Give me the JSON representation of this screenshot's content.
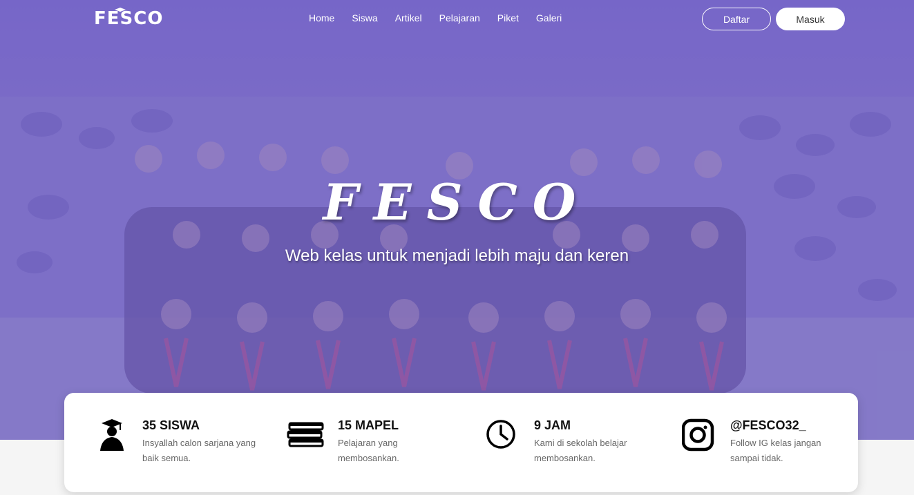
{
  "brand": {
    "logo_text": "FESCO"
  },
  "nav": {
    "links": [
      "Home",
      "Siswa",
      "Artikel",
      "Pelajaran",
      "Piket",
      "Galeri"
    ],
    "register_label": "Daftar",
    "login_label": "Masuk"
  },
  "hero": {
    "title": "FESCO",
    "subtitle": "Web kelas untuk menjadi lebih maju dan keren"
  },
  "stats": [
    {
      "icon": "graduate-icon",
      "title": "35 SISWA",
      "desc": "Insyallah calon sarjana yang baik semua."
    },
    {
      "icon": "books-icon",
      "title": "15 MAPEL",
      "desc": "Pelajaran yang membosankan."
    },
    {
      "icon": "clock-icon",
      "title": "9 JAM",
      "desc": "Kami di sekolah belajar membosankan."
    },
    {
      "icon": "instagram-icon",
      "title": "@FESCO32_",
      "desc": "Follow IG kelas jangan sampai tidak."
    }
  ],
  "colors": {
    "overlay": "#6c5cc8",
    "card_bg": "#ffffff",
    "text_dark": "#111111",
    "text_muted": "#666666"
  }
}
